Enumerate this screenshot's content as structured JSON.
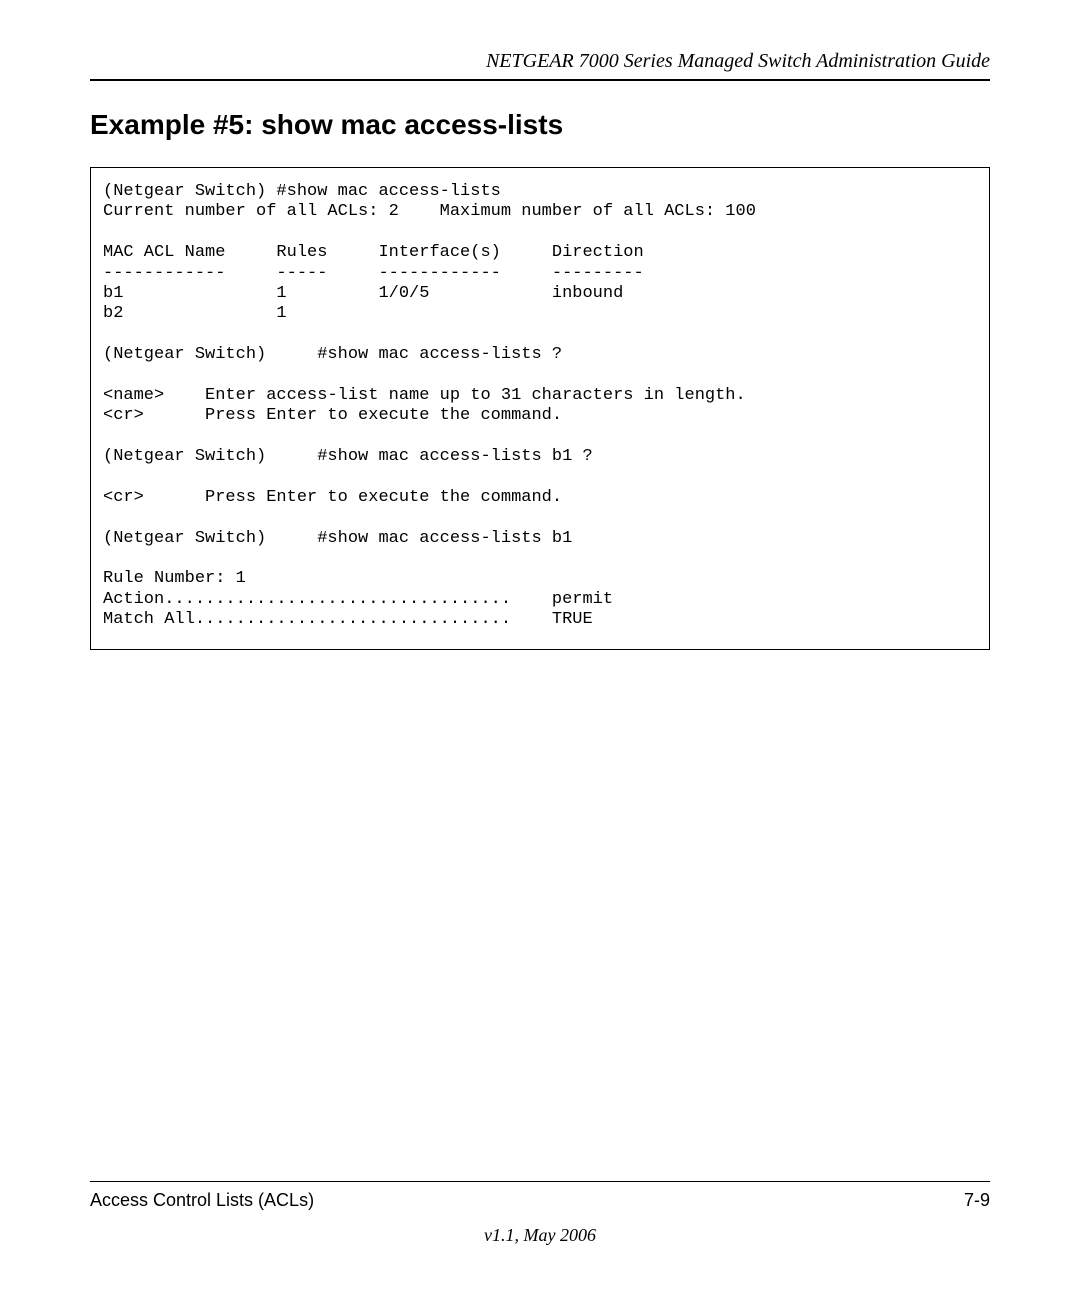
{
  "header": {
    "doc_title": "NETGEAR 7000  Series Managed Switch Administration Guide"
  },
  "section": {
    "title": "Example #5: show mac access-lists"
  },
  "code": {
    "text": "(Netgear Switch) #show mac access-lists\nCurrent number of all ACLs: 2    Maximum number of all ACLs: 100\n\nMAC ACL Name     Rules     Interface(s)     Direction\n------------     -----     ------------     ---------\nb1               1         1/0/5            inbound\nb2               1\n\n(Netgear Switch)     #show mac access-lists ?\n\n<name>    Enter access-list name up to 31 characters in length.\n<cr>      Press Enter to execute the command.\n\n(Netgear Switch)     #show mac access-lists b1 ?\n\n<cr>      Press Enter to execute the command.\n\n(Netgear Switch)     #show mac access-lists b1\n\nRule Number: 1\nAction..................................    permit\nMatch All...............................    TRUE"
  },
  "footer": {
    "section_name": "Access Control Lists (ACLs)",
    "page_number": "7-9",
    "version": "v1.1, May 2006"
  }
}
